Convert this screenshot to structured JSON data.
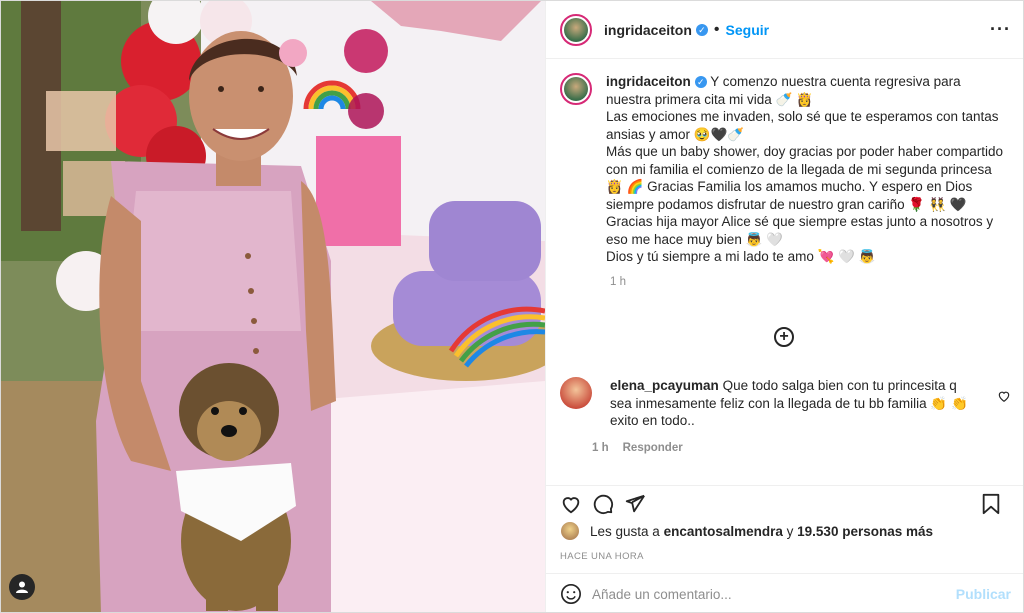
{
  "header": {
    "username": "ingridaceiton",
    "separator": "•",
    "follow_label": "Seguir",
    "more_icon": "more-horizontal-icon"
  },
  "post": {
    "username": "ingridaceiton",
    "caption": "Y comenzo nuestra cuenta regresiva para nuestra primera cita mi vida 🍼 👸\nLas emociones me invaden, solo sé que te esperamos con tantas ansias y amor 🥹🖤🍼\nMás que un baby shower, doy gracias por poder haber compartido con mi familia el comienzo de la llegada de mi segunda princesa 👸 🌈 Gracias Familia los amamos mucho. Y espero en Dios siempre podamos disfrutar de nuestro gran cariño 🌹 👯 🖤\nGracias hija mayor Alice sé que siempre estas junto a nosotros y eso me hace muy bien 👼 🤍\nDios y tú siempre a mi lado te amo 💘 🤍 👼",
    "time": "1 h"
  },
  "comment": {
    "username": "elena_pcayuman",
    "text": "Que todo salga bien con tu princesita q sea inmesamente feliz con la llegada de tu bb familia 👏 👏 exito en todo..",
    "time": "1 h",
    "reply_label": "Responder"
  },
  "likes": {
    "prefix": "Les gusta a",
    "user": "encantosalmendra",
    "connector": "y",
    "count": "19.530 personas más"
  },
  "posted_ago": "HACE UNA HORA",
  "add_comment": {
    "placeholder": "Añade un comentario...",
    "publish_label": "Publicar"
  },
  "colors": {
    "accent": "#0095f6",
    "publish_disabled": "#b2dffc",
    "verified": "#3897f0"
  }
}
